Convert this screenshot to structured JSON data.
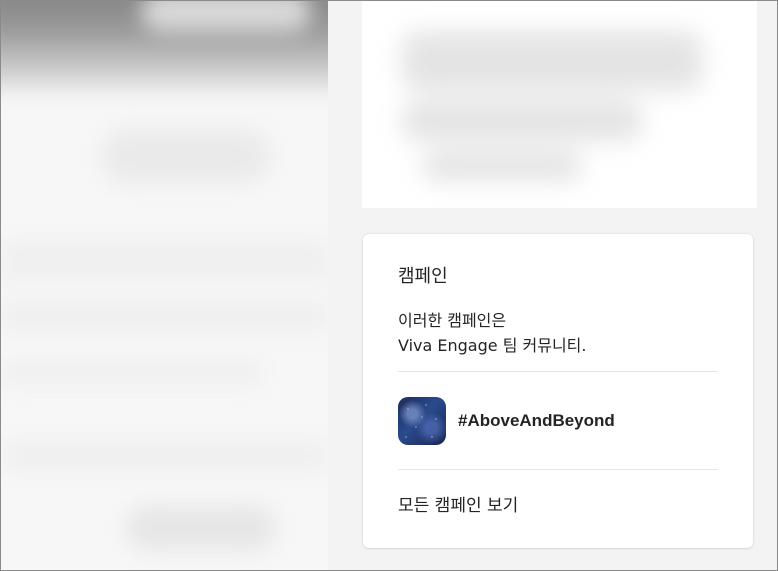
{
  "campaigns": {
    "title": "캠페인",
    "description_line1": "이러한 캠페인은",
    "description_line2": "Viva Engage 팀 커뮤니티.",
    "items": [
      {
        "name": "#AboveAndBeyond",
        "icon": "starry-sky-thumbnail"
      }
    ],
    "view_all_label": "모든 캠페인 보기"
  },
  "colors": {
    "page_background": "#f3f3f3",
    "card_background": "#ffffff",
    "text": "#242424",
    "divider": "#e6e6e6"
  }
}
